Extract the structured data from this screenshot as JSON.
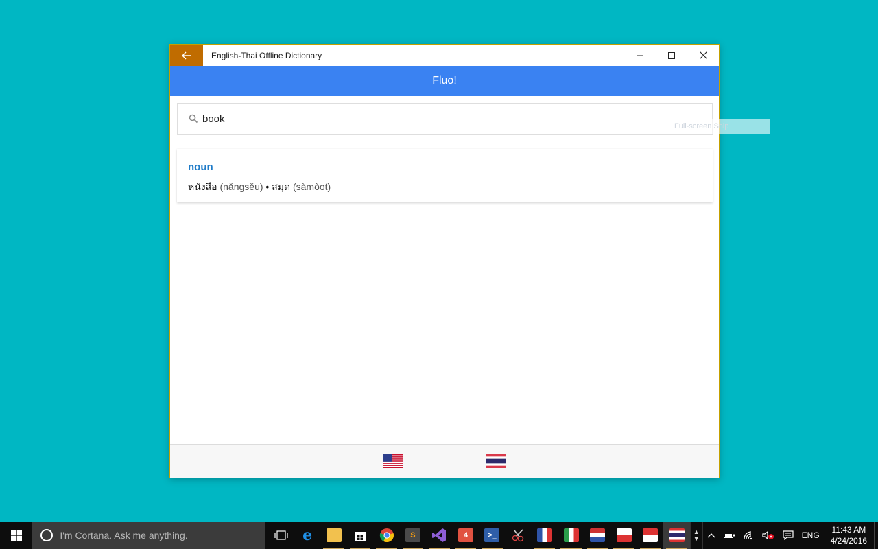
{
  "window": {
    "title": "English-Thai Offline Dictionary",
    "accent_color": "#c06c00",
    "header_color": "#3a82f2"
  },
  "header": {
    "title": "Fluo!"
  },
  "search": {
    "value": "book",
    "placeholder": ""
  },
  "ghost_tooltip": "Full-screen Snip",
  "results": [
    {
      "part_of_speech": "noun",
      "thai_1": "หนังสือ",
      "roman_1": "(nǎngsěu)",
      "separator": "•",
      "thai_2": "สมุด",
      "roman_2": "(sàmòot)"
    }
  ],
  "footer": {
    "flags": [
      "us-flag-icon",
      "thailand-flag-icon"
    ]
  },
  "taskbar": {
    "cortana_placeholder": "I'm Cortana. Ask me anything.",
    "language": "ENG",
    "time": "11:43 AM",
    "date": "4/24/2016"
  }
}
